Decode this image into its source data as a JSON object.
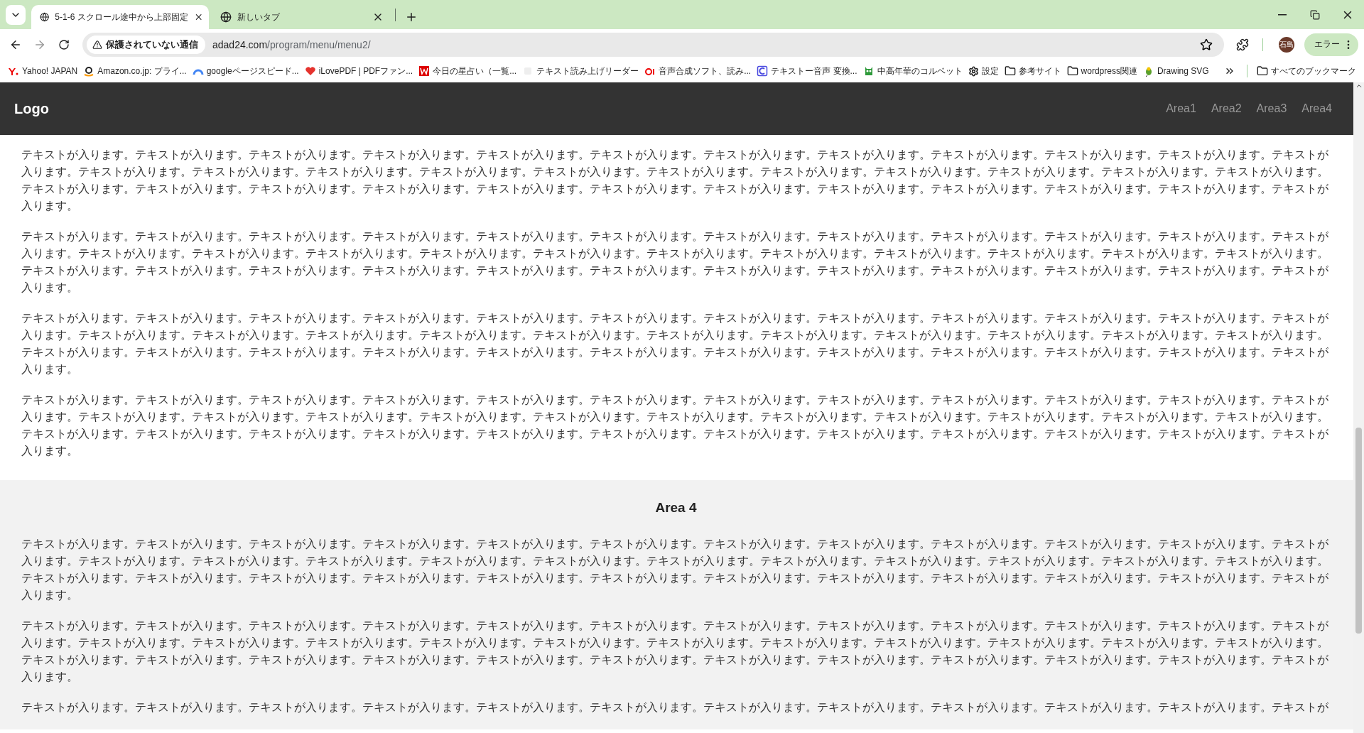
{
  "browser": {
    "tabs": [
      {
        "title": "5-1-6 スクロール途中から上部固定",
        "selected": true
      },
      {
        "title": "新しいタブ",
        "selected": false
      }
    ],
    "address": {
      "security_label": "保護されていない通信",
      "host": "adad24.com",
      "path": "/program/menu/menu2/"
    },
    "profile": {
      "initials": "石島"
    },
    "error_button": "エラー",
    "bookmarks": [
      {
        "label": "Yahoo! JAPAN",
        "kind": "yahoo"
      },
      {
        "label": "Amazon.co.jp: プライ...",
        "kind": "amazon"
      },
      {
        "label": "googleページスピード...",
        "kind": "arc"
      },
      {
        "label": "iLovePDF | PDFファン...",
        "kind": "heart"
      },
      {
        "label": "今日の星占い（一覧...",
        "kind": "square"
      },
      {
        "label": "テキスト読み上げリーダー",
        "kind": "blank"
      },
      {
        "label": "音声合成ソフト、読み...",
        "kind": "ai"
      },
      {
        "label": "テキストー音声 変換...",
        "kind": "outline"
      },
      {
        "label": "中高年華のコルベット",
        "kind": "owl"
      },
      {
        "label": "設定",
        "kind": "gear"
      },
      {
        "label": "参考サイト",
        "kind": "folder"
      },
      {
        "label": "wordpress関連",
        "kind": "folder"
      },
      {
        "label": "Drawing SVG",
        "kind": "bird"
      }
    ],
    "all_bookmarks": "すべてのブックマーク"
  },
  "header": {
    "logo": "Logo",
    "nav": [
      "Area1",
      "Area2",
      "Area3",
      "Area4"
    ]
  },
  "sections": [
    {
      "kind": "plain",
      "paragraphs": [
        "テキストが入ります。テキストが入ります。テキストが入ります。テキストが入ります。テキストが入ります。テキストが入ります。テキストが入ります。テキストが入ります。テキストが入ります。テキストが入ります。テキストが入ります。テキストが入ります。テキストが入ります。テキストが入ります。テキストが入ります。テキストが入ります。テキストが入ります。テキストが入ります。テキストが入ります。テキストが入ります。テキストが入ります。テキストが入ります。テキストが入ります。テキストが入ります。テキストが入ります。テキストが入ります。テキストが入ります。テキストが入ります。テキストが入ります。テキストが入ります。テキストが入ります。テキストが入ります。テキストが入ります。テキストが入ります。テキストが入ります。",
        "テキストが入ります。テキストが入ります。テキストが入ります。テキストが入ります。テキストが入ります。テキストが入ります。テキストが入ります。テキストが入ります。テキストが入ります。テキストが入ります。テキストが入ります。テキストが入ります。テキストが入ります。テキストが入ります。テキストが入ります。テキストが入ります。テキストが入ります。テキストが入ります。テキストが入ります。テキストが入ります。テキストが入ります。テキストが入ります。テキストが入ります。テキストが入ります。テキストが入ります。テキストが入ります。テキストが入ります。テキストが入ります。テキストが入ります。テキストが入ります。テキストが入ります。テキストが入ります。テキストが入ります。テキストが入ります。テキストが入ります。",
        "テキストが入ります。テキストが入ります。テキストが入ります。テキストが入ります。テキストが入ります。テキストが入ります。テキストが入ります。テキストが入ります。テキストが入ります。テキストが入ります。テキストが入ります。テキストが入ります。テキストが入ります。テキストが入ります。テキストが入ります。テキストが入ります。テキストが入ります。テキストが入ります。テキストが入ります。テキストが入ります。テキストが入ります。テキストが入ります。テキストが入ります。テキストが入ります。テキストが入ります。テキストが入ります。テキストが入ります。テキストが入ります。テキストが入ります。テキストが入ります。テキストが入ります。テキストが入ります。テキストが入ります。テキストが入ります。テキストが入ります。",
        "テキストが入ります。テキストが入ります。テキストが入ります。テキストが入ります。テキストが入ります。テキストが入ります。テキストが入ります。テキストが入ります。テキストが入ります。テキストが入ります。テキストが入ります。テキストが入ります。テキストが入ります。テキストが入ります。テキストが入ります。テキストが入ります。テキストが入ります。テキストが入ります。テキストが入ります。テキストが入ります。テキストが入ります。テキストが入ります。テキストが入ります。テキストが入ります。テキストが入ります。テキストが入ります。テキストが入ります。テキストが入ります。テキストが入ります。テキストが入ります。テキストが入ります。テキストが入ります。テキストが入ります。テキストが入ります。テキストが入ります。"
      ]
    },
    {
      "kind": "shaded",
      "heading": "Area 4",
      "paragraphs": [
        "テキストが入ります。テキストが入ります。テキストが入ります。テキストが入ります。テキストが入ります。テキストが入ります。テキストが入ります。テキストが入ります。テキストが入ります。テキストが入ります。テキストが入ります。テキストが入ります。テキストが入ります。テキストが入ります。テキストが入ります。テキストが入ります。テキストが入ります。テキストが入ります。テキストが入ります。テキストが入ります。テキストが入ります。テキストが入ります。テキストが入ります。テキストが入ります。テキストが入ります。テキストが入ります。テキストが入ります。テキストが入ります。テキストが入ります。テキストが入ります。テキストが入ります。テキストが入ります。テキストが入ります。テキストが入ります。テキストが入ります。",
        "テキストが入ります。テキストが入ります。テキストが入ります。テキストが入ります。テキストが入ります。テキストが入ります。テキストが入ります。テキストが入ります。テキストが入ります。テキストが入ります。テキストが入ります。テキストが入ります。テキストが入ります。テキストが入ります。テキストが入ります。テキストが入ります。テキストが入ります。テキストが入ります。テキストが入ります。テキストが入ります。テキストが入ります。テキストが入ります。テキストが入ります。テキストが入ります。テキストが入ります。テキストが入ります。テキストが入ります。テキストが入ります。テキストが入ります。テキストが入ります。テキストが入ります。テキストが入ります。テキストが入ります。テキストが入ります。テキストが入ります。",
        "テキストが入ります。テキストが入ります。テキストが入ります。テキストが入ります。テキストが入ります。テキストが入ります。テキストが入ります。テキストが入ります。テキストが入ります。テキストが入ります。テキストが入ります。テキストが"
      ]
    }
  ]
}
